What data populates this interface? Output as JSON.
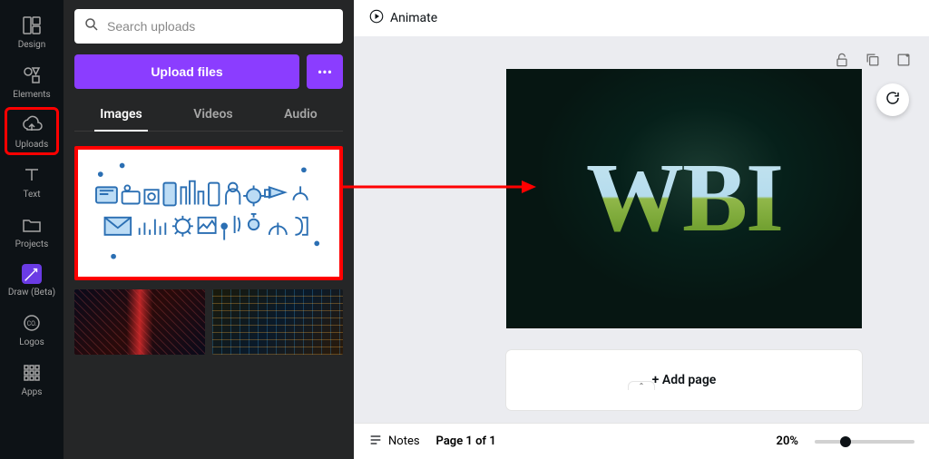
{
  "nav": {
    "design": "Design",
    "elements": "Elements",
    "uploads": "Uploads",
    "text": "Text",
    "projects": "Projects",
    "draw": "Draw (Beta)",
    "logos": "Logos",
    "apps": "Apps"
  },
  "panel": {
    "search_placeholder": "Search uploads",
    "upload_button": "Upload files",
    "tabs": {
      "images": "Images",
      "videos": "Videos",
      "audio": "Audio"
    }
  },
  "header": {
    "animate": "Animate"
  },
  "design": {
    "main_text": "WBI"
  },
  "canvas": {
    "add_page": "+ Add page"
  },
  "footer": {
    "notes": "Notes",
    "page_info": "Page 1 of 1",
    "zoom": "20%"
  }
}
